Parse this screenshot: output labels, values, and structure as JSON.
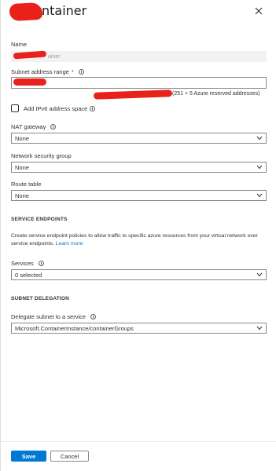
{
  "header": {
    "title_visible": "ntainer",
    "close_icon": "close-icon"
  },
  "name": {
    "label": "Name",
    "value_partial": "ainer"
  },
  "subnet_range": {
    "label": "Subnet address range",
    "required_mark": "*",
    "note": "(251 + 5 Azure reserved addresses)"
  },
  "ipv6": {
    "label": "Add IPv6 address space"
  },
  "nat_gateway": {
    "label": "NAT gateway",
    "value": "None"
  },
  "nsg": {
    "label": "Network security group",
    "value": "None"
  },
  "route_table": {
    "label": "Route table",
    "value": "None"
  },
  "service_endpoints": {
    "heading": "SERVICE ENDPOINTS",
    "description": "Create service endpoint policies to allow traffic to specific azure resources from your virtual network over service endpoints.",
    "learn_more": "Learn more",
    "services_label": "Services",
    "services_value": "0 selected"
  },
  "delegation": {
    "heading": "SUBNET DELEGATION",
    "label": "Delegate subnet to a service",
    "value": "Microsoft.ContainerInstance/containerGroups"
  },
  "footer": {
    "save": "Save",
    "cancel": "Cancel"
  },
  "colors": {
    "primary": "#0078d4",
    "redaction": "#e8221b",
    "required": "#a4262c"
  }
}
